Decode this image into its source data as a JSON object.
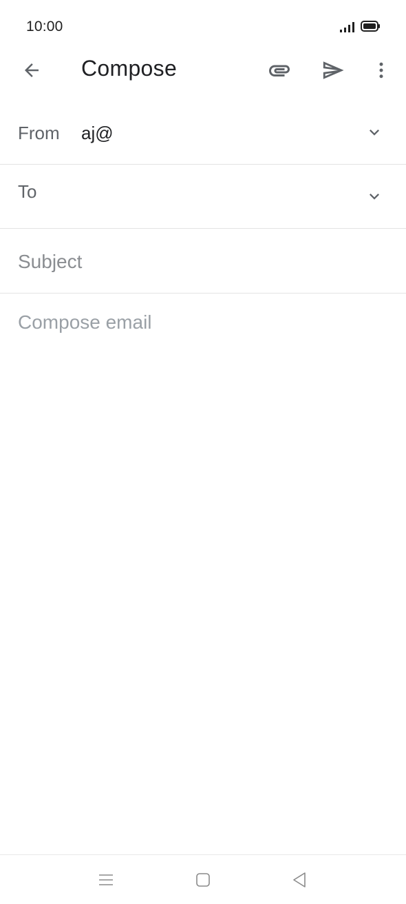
{
  "status_bar": {
    "time": "10:00",
    "icons": [
      "signal-icon",
      "battery-icon"
    ]
  },
  "app_bar": {
    "title": "Compose",
    "icons": [
      "back-arrow-icon",
      "paperclip-icon",
      "send-icon",
      "more-vert-icon"
    ]
  },
  "form": {
    "from_label": "From",
    "from_value": "aj@",
    "to_label": "To",
    "subject_placeholder": "Subject",
    "body_placeholder": "Compose email"
  },
  "nav_bar": {
    "icons": [
      "menu-icon",
      "home-square-icon",
      "back-triangle-icon"
    ]
  },
  "colors": {
    "title": "#202124",
    "label": "#5f6368",
    "placeholder": "#9aa0a6",
    "divider": "#e3e3e3",
    "icon": "#5f6368"
  }
}
